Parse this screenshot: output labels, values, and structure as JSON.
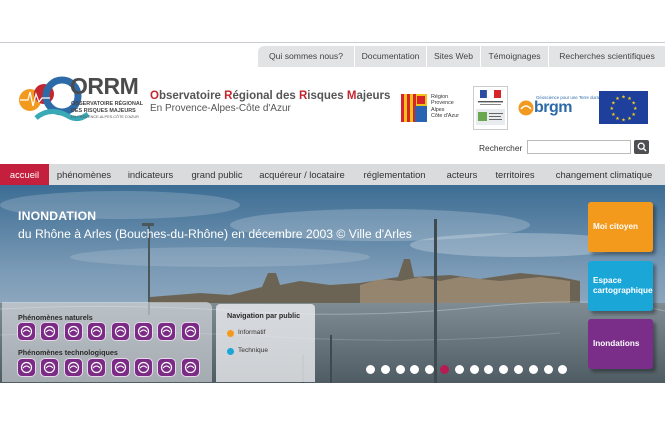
{
  "utility_nav": [
    "Qui sommes nous?",
    "Documentation",
    "Sites Web",
    "Témoignages",
    "Recherches scientifiques"
  ],
  "logo": {
    "acronym": "ORRM",
    "tagline_1": "OBSERVATOIRE RÉGIONAL",
    "tagline_2": "DES RISQUES MAJEURS",
    "tagline_3": "EN PROVENCE-ALPES-CÔTE D'AZUR"
  },
  "site": {
    "title_parts": [
      "O",
      "bservatoire ",
      "R",
      "égional des ",
      "R",
      "isques ",
      "M",
      "ajeurs"
    ],
    "subtitle": "En Provence-Alpes-Côte d'Azur"
  },
  "partners": {
    "region_lines": [
      "Région",
      "Provence",
      "Alpes",
      "Côte d'Azur"
    ],
    "brgm_top": "Géoscience pour une Terre durable",
    "brgm": "brgm"
  },
  "search": {
    "label": "Rechercher",
    "value": ""
  },
  "main_nav": [
    "accueil",
    "phénomènes",
    "indicateurs",
    "grand public",
    "acquéreur / locataire",
    "réglementation",
    "acteurs",
    "territoires",
    "changement climatique"
  ],
  "hero": {
    "title": "INONDATION",
    "caption": "du Rhône à Arles (Bouches-du-Rhône) en décembre 2003 © Ville d'Arles",
    "slide_count": 14,
    "active_slide": 5
  },
  "phenomena": {
    "natural_label": "Phénomènes naturels",
    "technological_label": "Phénomènes technologiques",
    "natural_icons": [
      "earthquake-icon",
      "avalanche-icon",
      "forest-fire-icon",
      "seismic-wave-icon",
      "landslide-icon",
      "flood-wave-icon",
      "storm-icon",
      "volcano-icon"
    ],
    "technological_icons": [
      "industrial-icon",
      "nuclear-icon",
      "dam-icon",
      "transport-icon",
      "mining-icon",
      "gas-icon",
      "factory-icon",
      "chemical-icon"
    ]
  },
  "public_nav": {
    "title": "Navigation par public",
    "options": [
      "Informatif",
      "Technique"
    ]
  },
  "tiles": [
    "Moi citoyen",
    "Espace cartographique",
    "Inondations"
  ],
  "colors": {
    "accent_red": "#c41f3d",
    "tile_orange": "#f39a1c",
    "tile_cyan": "#1aa6d6",
    "tile_purple": "#7a2e8a",
    "icon_purple": "#7b2b86"
  }
}
